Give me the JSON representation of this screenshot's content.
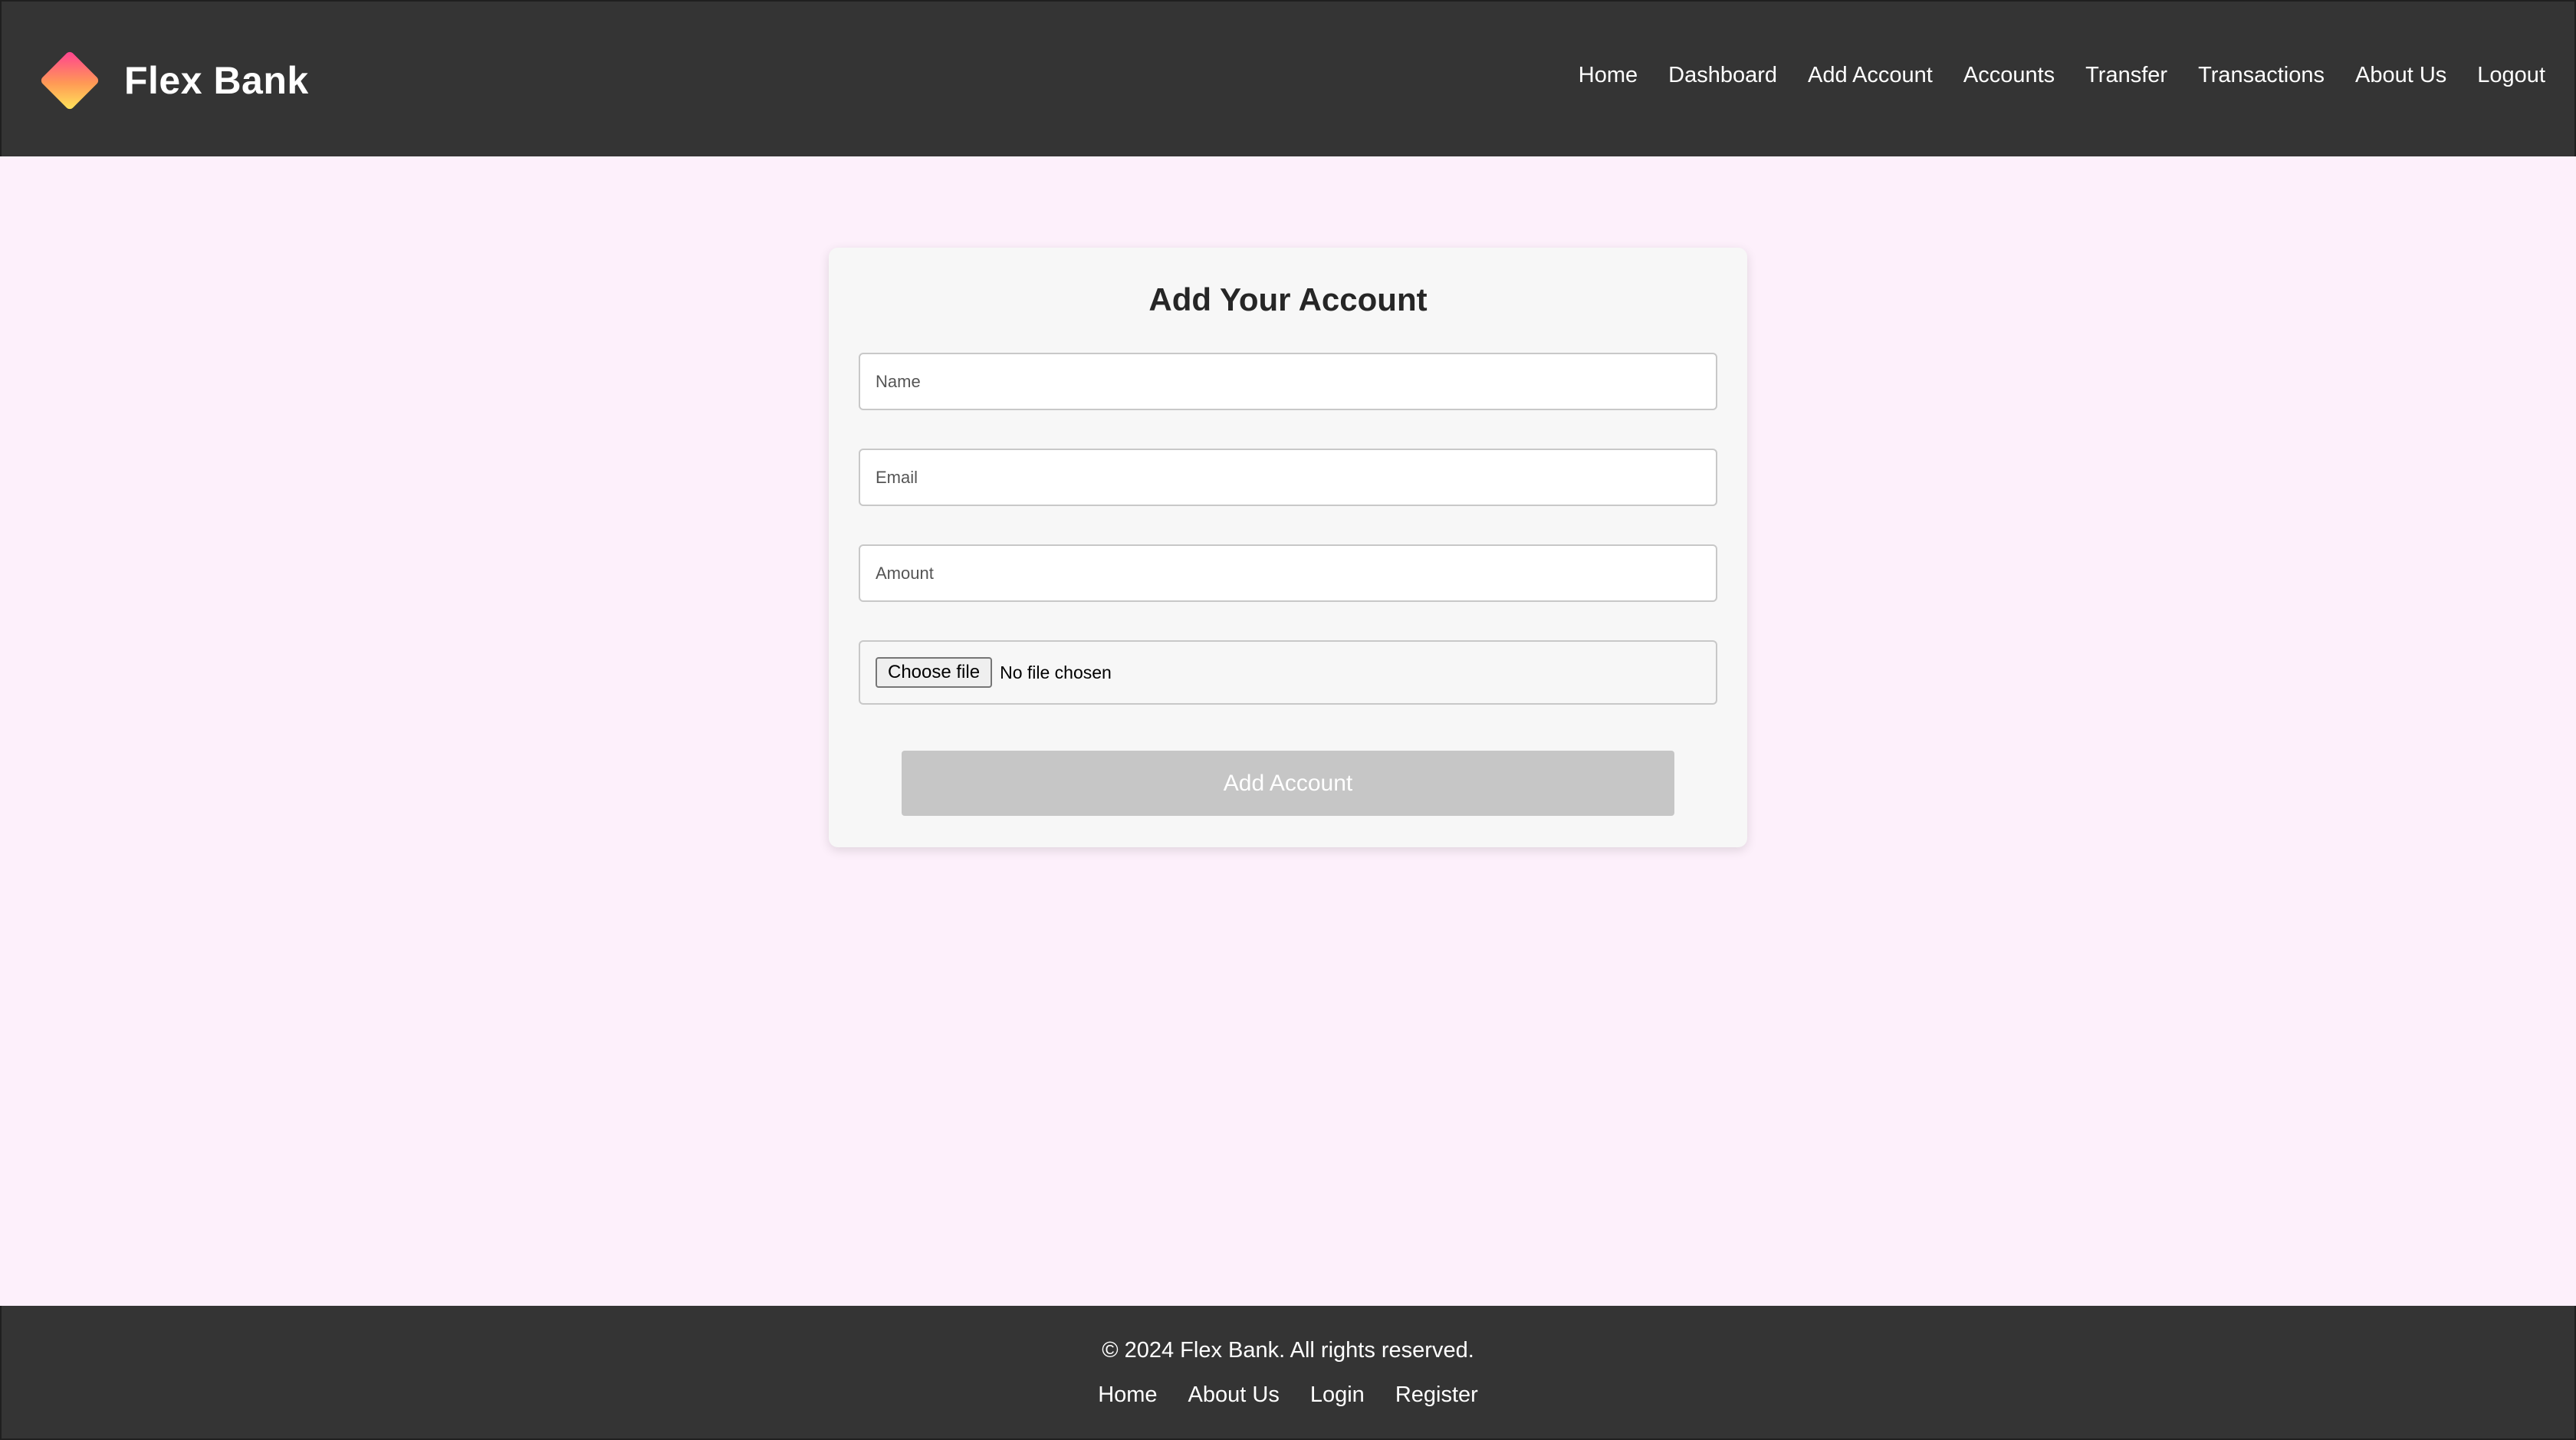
{
  "brand": {
    "name": "Flex Bank",
    "logo_icon": "diamond-gradient-logo",
    "logo_colors": [
      "#ff4f8b",
      "#ffb347",
      "#ffe45c"
    ]
  },
  "nav": {
    "items": [
      "Home",
      "Dashboard",
      "Add Account",
      "Accounts",
      "Transfer",
      "Transactions",
      "About Us",
      "Logout"
    ]
  },
  "form": {
    "title": "Add Your Account",
    "name_placeholder": "Name",
    "email_placeholder": "Email",
    "amount_placeholder": "Amount",
    "file_button_label": "Choose file",
    "file_status": "No file chosen",
    "submit_label": "Add Account"
  },
  "footer": {
    "copyright": "© 2024 Flex Bank. All rights reserved.",
    "links": [
      "Home",
      "About Us",
      "Login",
      "Register"
    ]
  },
  "colors": {
    "header_bg": "#343434",
    "page_bg": "#fdf0fb",
    "card_bg": "#f7f7f7",
    "button_disabled": "#c6c6c6"
  }
}
